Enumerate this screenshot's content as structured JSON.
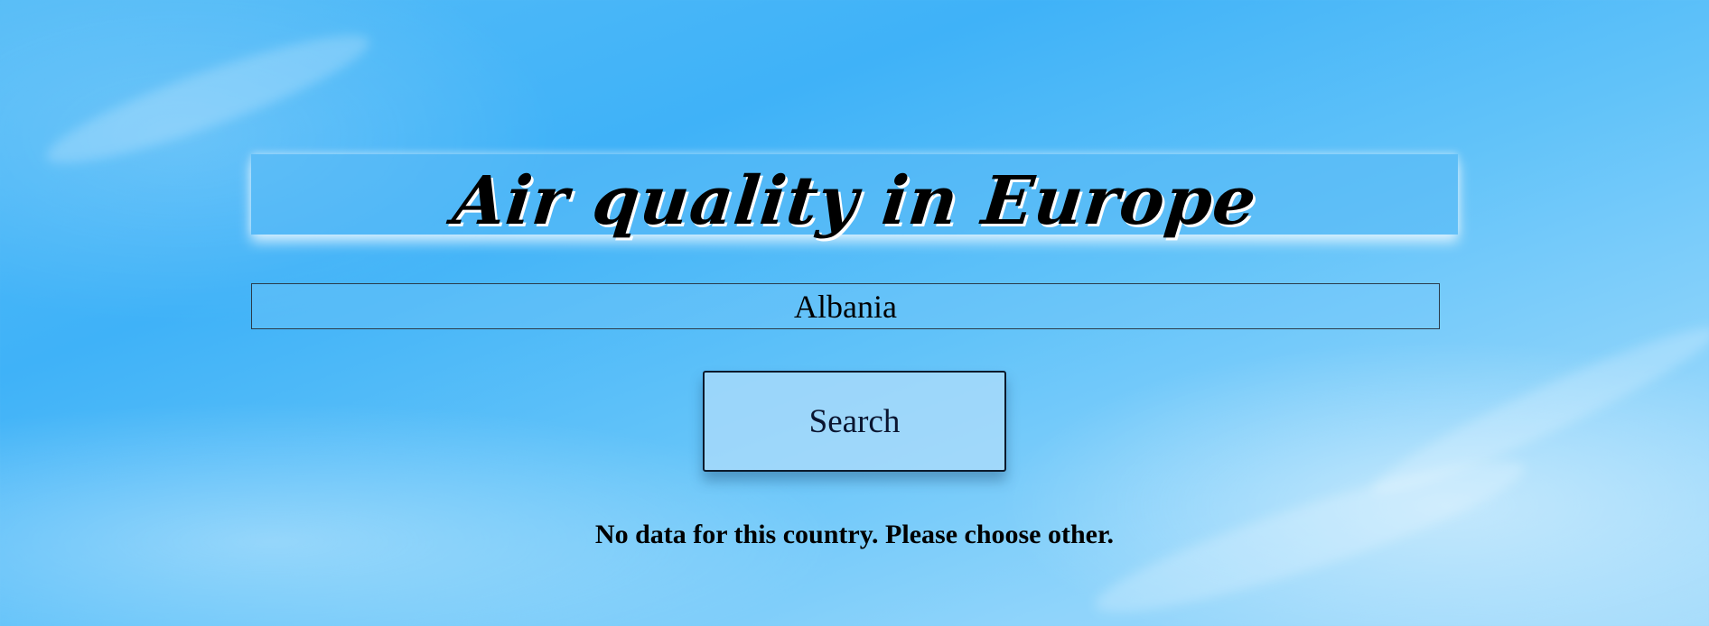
{
  "header": {
    "title": "Air quality in Europe"
  },
  "search": {
    "country_value": "Albania",
    "button_label": "Search"
  },
  "status": {
    "message": "No data for this country. Please choose other."
  },
  "colors": {
    "sky_top": "#3fb2f8",
    "sky_bottom": "#a6dcfb",
    "text": "#000000",
    "button_border": "#0c1a2c"
  }
}
